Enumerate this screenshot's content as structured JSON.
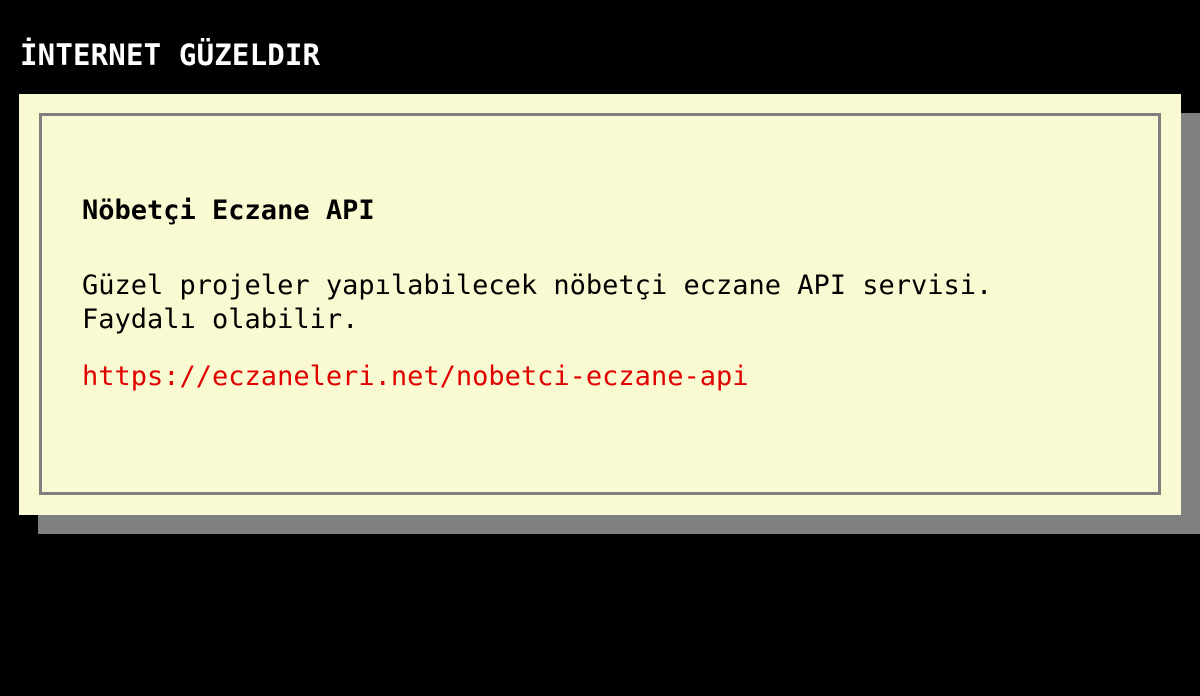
{
  "site": {
    "title": "İNTERNET GÜZELDIR"
  },
  "post": {
    "title": "Nöbetçi Eczane API",
    "description": "Güzel projeler yapılabilecek nöbetçi eczane API servisi. Faydalı olabilir.",
    "link": "https://eczaneleri.net/nobetci-eczane-api"
  },
  "colors": {
    "page_background": "#000000",
    "card_background": "#fafad2",
    "card_border": "#808080",
    "card_shadow": "#808080",
    "link": "#e00000",
    "title_text": "#ffffff"
  }
}
